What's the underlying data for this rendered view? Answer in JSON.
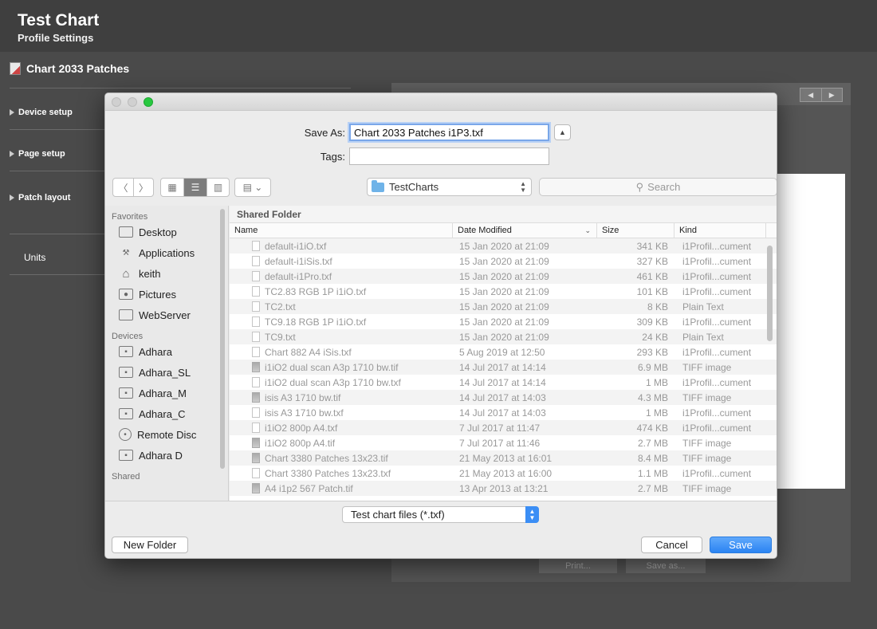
{
  "app": {
    "title": "Test Chart",
    "subtitle": "Profile Settings",
    "chart_heading": "Chart 2033 Patches",
    "side_items": [
      "Device setup",
      "Page setup",
      "Patch layout"
    ],
    "units_label": "Units",
    "print_button": "Print...",
    "saveas_button": "Save as..."
  },
  "dialog": {
    "save_as_label": "Save As:",
    "save_as_value": "Chart 2033 Patches i1P3.txf",
    "tags_label": "Tags:",
    "tags_value": "",
    "current_folder": "TestCharts",
    "search_placeholder": "Search",
    "sidebar": {
      "favorites_header": "Favorites",
      "favorites": [
        {
          "label": "Desktop",
          "icon": "desktop-icon"
        },
        {
          "label": "Applications",
          "icon": "applications-icon"
        },
        {
          "label": "keith",
          "icon": "home-icon"
        },
        {
          "label": "Pictures",
          "icon": "camera-icon"
        },
        {
          "label": "WebServer",
          "icon": "folder-icon"
        }
      ],
      "devices_header": "Devices",
      "devices": [
        {
          "label": "Adhara",
          "icon": "disk-icon"
        },
        {
          "label": "Adhara_SL",
          "icon": "disk-icon"
        },
        {
          "label": "Adhara_M",
          "icon": "disk-icon"
        },
        {
          "label": "Adhara_C",
          "icon": "disk-icon"
        },
        {
          "label": "Remote Disc",
          "icon": "disc-icon"
        },
        {
          "label": "Adhara D",
          "icon": "disk-icon"
        }
      ],
      "shared_header": "Shared"
    },
    "shared_folder_label": "Shared Folder",
    "columns": {
      "name": "Name",
      "date": "Date Modified",
      "size": "Size",
      "kind": "Kind"
    },
    "files": [
      {
        "name": "default-i1iO.txf",
        "date": "15 Jan 2020 at 21:09",
        "size": "341 KB",
        "kind": "i1Profil...cument"
      },
      {
        "name": "default-i1iSis.txf",
        "date": "15 Jan 2020 at 21:09",
        "size": "327 KB",
        "kind": "i1Profil...cument"
      },
      {
        "name": "default-i1Pro.txf",
        "date": "15 Jan 2020 at 21:09",
        "size": "461 KB",
        "kind": "i1Profil...cument"
      },
      {
        "name": "TC2.83 RGB 1P i1iO.txf",
        "date": "15 Jan 2020 at 21:09",
        "size": "101 KB",
        "kind": "i1Profil...cument"
      },
      {
        "name": "TC2.txt",
        "date": "15 Jan 2020 at 21:09",
        "size": "8 KB",
        "kind": "Plain Text"
      },
      {
        "name": "TC9.18 RGB 1P i1iO.txf",
        "date": "15 Jan 2020 at 21:09",
        "size": "309 KB",
        "kind": "i1Profil...cument"
      },
      {
        "name": "TC9.txt",
        "date": "15 Jan 2020 at 21:09",
        "size": "24 KB",
        "kind": "Plain Text"
      },
      {
        "name": "Chart 882 A4 iSis.txf",
        "date": "5 Aug 2019 at 12:50",
        "size": "293 KB",
        "kind": "i1Profil...cument"
      },
      {
        "name": "i1iO2 dual scan A3p 1710 bw.tif",
        "date": "14 Jul 2017 at 14:14",
        "size": "6.9 MB",
        "kind": "TIFF image"
      },
      {
        "name": "i1iO2 dual scan A3p 1710 bw.txf",
        "date": "14 Jul 2017 at 14:14",
        "size": "1 MB",
        "kind": "i1Profil...cument"
      },
      {
        "name": "isis A3 1710 bw.tif",
        "date": "14 Jul 2017 at 14:03",
        "size": "4.3 MB",
        "kind": "TIFF image"
      },
      {
        "name": "isis A3 1710 bw.txf",
        "date": "14 Jul 2017 at 14:03",
        "size": "1 MB",
        "kind": "i1Profil...cument"
      },
      {
        "name": "i1iO2 800p A4.txf",
        "date": "7 Jul 2017 at 11:47",
        "size": "474 KB",
        "kind": "i1Profil...cument"
      },
      {
        "name": "i1iO2 800p A4.tif",
        "date": "7 Jul 2017 at 11:46",
        "size": "2.7 MB",
        "kind": "TIFF image"
      },
      {
        "name": "Chart 3380 Patches 13x23.tif",
        "date": "21 May 2013 at 16:01",
        "size": "8.4 MB",
        "kind": "TIFF image"
      },
      {
        "name": "Chart 3380 Patches 13x23.txf",
        "date": "21 May 2013 at 16:00",
        "size": "1.1 MB",
        "kind": "i1Profil...cument"
      },
      {
        "name": "A4 i1p2 567 Patch.tif",
        "date": "13 Apr 2013 at 13:21",
        "size": "2.7 MB",
        "kind": "TIFF image"
      }
    ],
    "file_format": "Test chart files (*.txf)",
    "new_folder_button": "New Folder",
    "cancel_button": "Cancel",
    "save_button": "Save"
  },
  "colors": {
    "accent": "#3b8ef5",
    "window_close": "#d0d0d0",
    "window_zoom": "#28c840"
  }
}
